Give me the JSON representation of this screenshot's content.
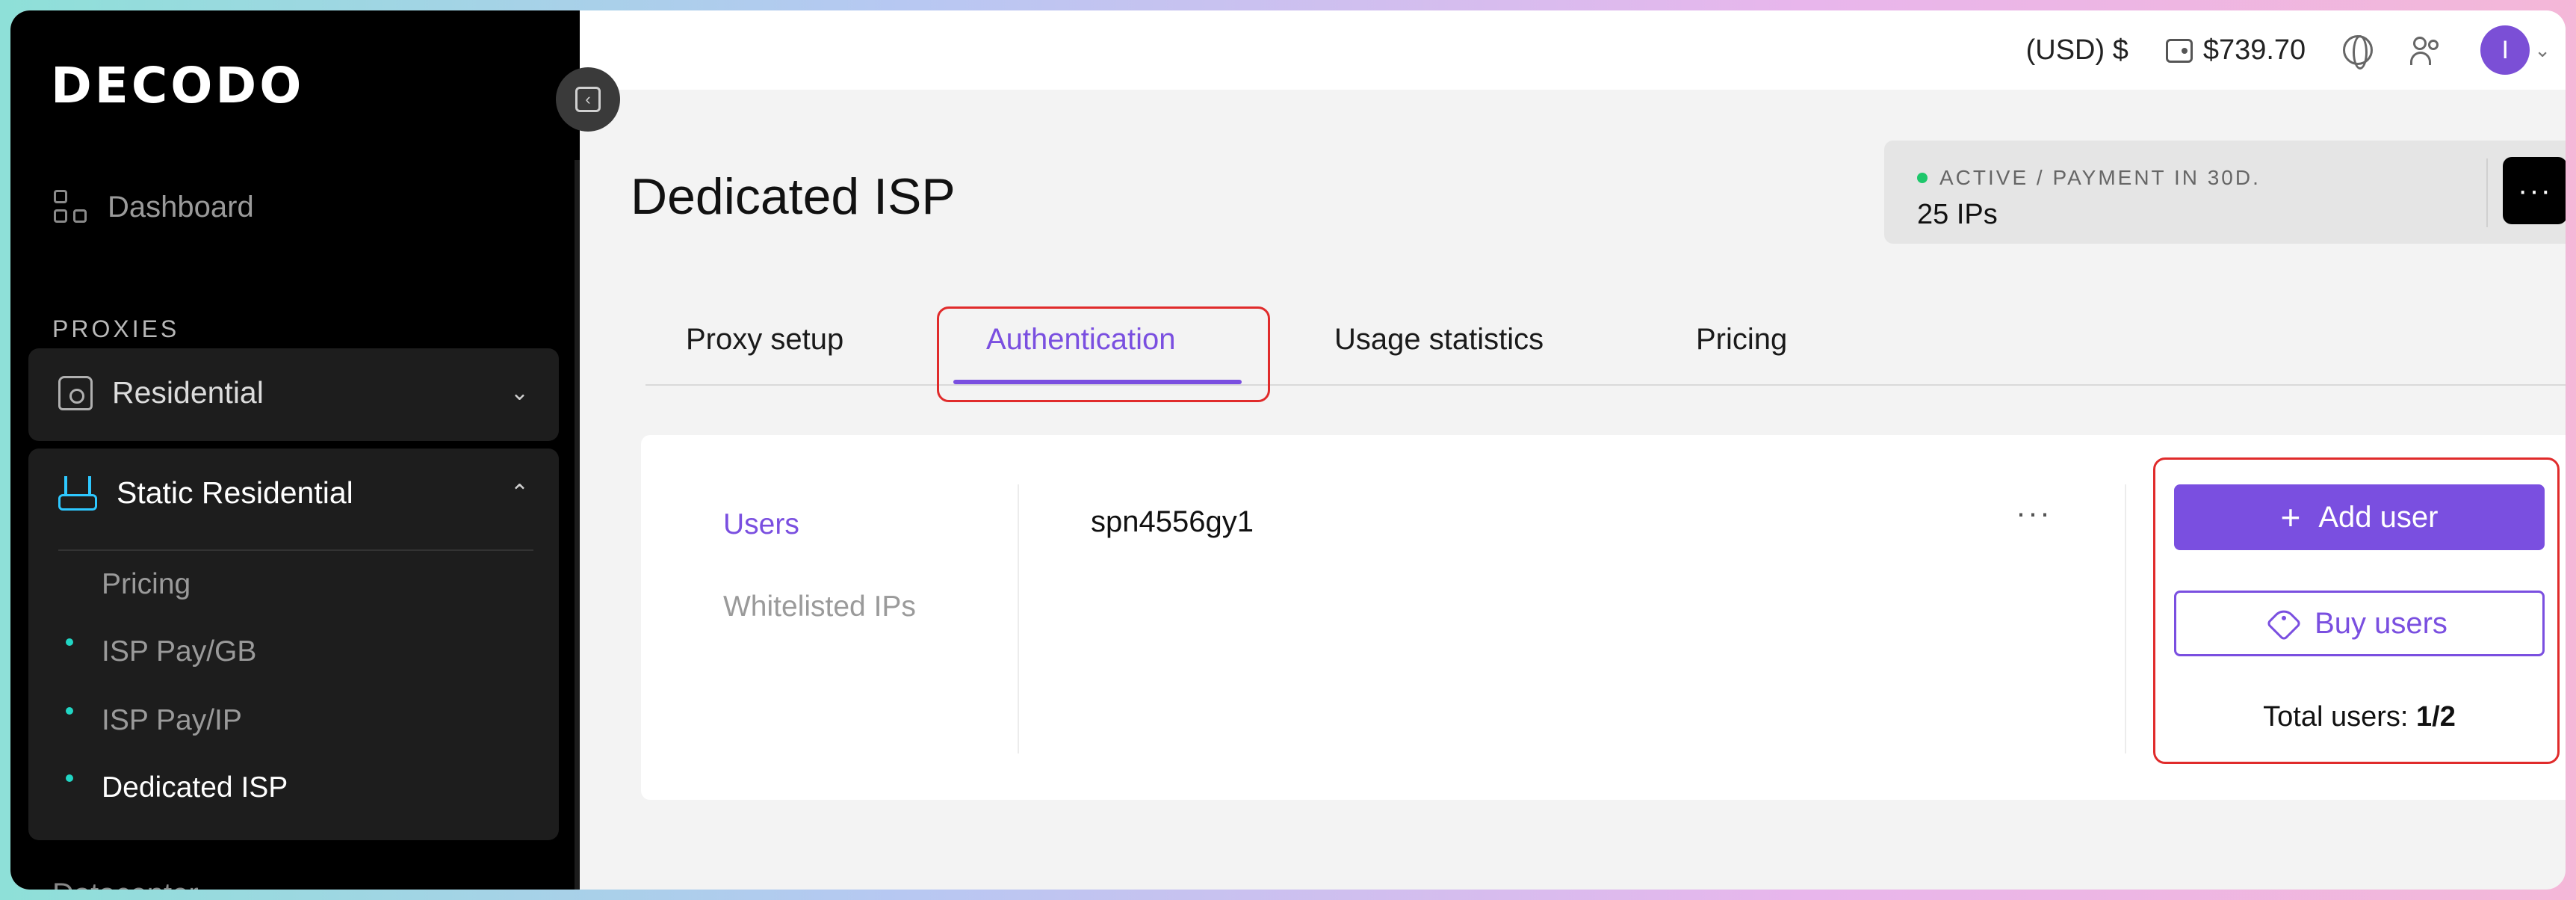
{
  "sidebar": {
    "logo": "DECODO",
    "dashboard_label": "Dashboard",
    "section_label": "PROXIES",
    "residential_label": "Residential",
    "static_residential_label": "Static Residential",
    "static_items": [
      "Pricing",
      "ISP Pay/GB",
      "ISP Pay/IP",
      "Dedicated ISP"
    ],
    "next_item_label": "Datacenter"
  },
  "topbar": {
    "currency": "(USD) $",
    "balance": "$739.70",
    "avatar_initial": "I"
  },
  "page": {
    "title": "Dedicated ISP",
    "status_text": "ACTIVE / PAYMENT IN 30D.",
    "ips_text": "25 IPs",
    "more_label": "···"
  },
  "tabs": [
    "Proxy setup",
    "Authentication",
    "Usage statistics",
    "Pricing"
  ],
  "auth": {
    "subnav": [
      "Users",
      "Whitelisted IPs"
    ],
    "username": "spn4556gy1",
    "row_more": "···",
    "add_user_label": "Add user",
    "buy_users_label": "Buy users",
    "total_users_label": "Total users:",
    "total_users_value": "1/2"
  },
  "colors": {
    "accent": "#7a4fe0",
    "highlight": "#e02b2b",
    "status_active": "#1ec76b",
    "sidebar_dot": "#21d6c4"
  }
}
